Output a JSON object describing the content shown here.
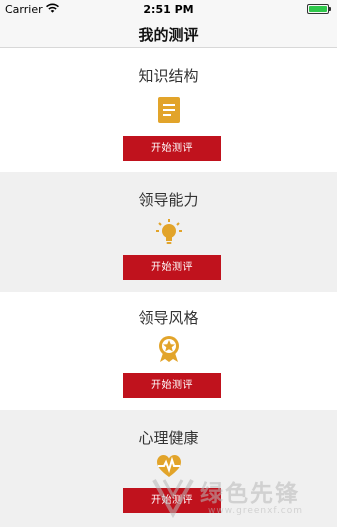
{
  "status_bar": {
    "carrier": "Carrier",
    "time": "2:51 PM",
    "battery_color": "#2fc84b"
  },
  "nav": {
    "title": "我的测评"
  },
  "sections": [
    {
      "name": "知识结构",
      "icon": "document-icon",
      "button": "开始测评"
    },
    {
      "name": "领导能力",
      "icon": "lightbulb-icon",
      "button": "开始测评"
    },
    {
      "name": "领导风格",
      "icon": "medal-icon",
      "button": "开始测评"
    },
    {
      "name": "心理健康",
      "icon": "heart-pulse-icon",
      "button": "开始测评"
    }
  ],
  "colors": {
    "button_red": "#c0121d",
    "icon_gold": "#e2a42a",
    "alt_section_bg": "#f0f0f0"
  },
  "watermark": {
    "text": "绿色先锋",
    "url": "www.greenxf.com"
  }
}
